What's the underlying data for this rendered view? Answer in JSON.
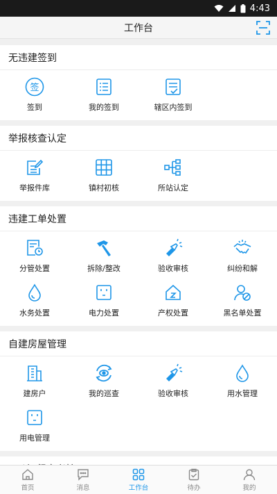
{
  "status_bar": {
    "time": "4:43"
  },
  "header": {
    "title": "工作台"
  },
  "sections": {
    "s1": {
      "title": "无违建签到",
      "items": [
        "签到",
        "我的签到",
        "辖区内签到"
      ],
      "icon_glyph": "签"
    },
    "s2": {
      "title": "举报核查认定",
      "items": [
        "举报件库",
        "镇村初核",
        "所站认定"
      ]
    },
    "s3": {
      "title": "违建工单处置",
      "items": [
        "分管处置",
        "拆除/整改",
        "验收审核",
        "纠纷和解",
        "水务处置",
        "电力处置",
        "产权处置",
        "黑名单处置"
      ]
    },
    "s4": {
      "title": "自建房屋管理",
      "items": [
        "建房户",
        "我的巡查",
        "验收审核",
        "用水管理",
        "用电管理"
      ]
    },
    "s5": {
      "title": "\"两违\"督察考核"
    }
  },
  "tabs": [
    "首页",
    "消息",
    "工作台",
    "待办",
    "我的"
  ],
  "colors": {
    "accent": "#1e96e8",
    "icon": "#1e96e8",
    "tab_inactive": "#888888"
  }
}
